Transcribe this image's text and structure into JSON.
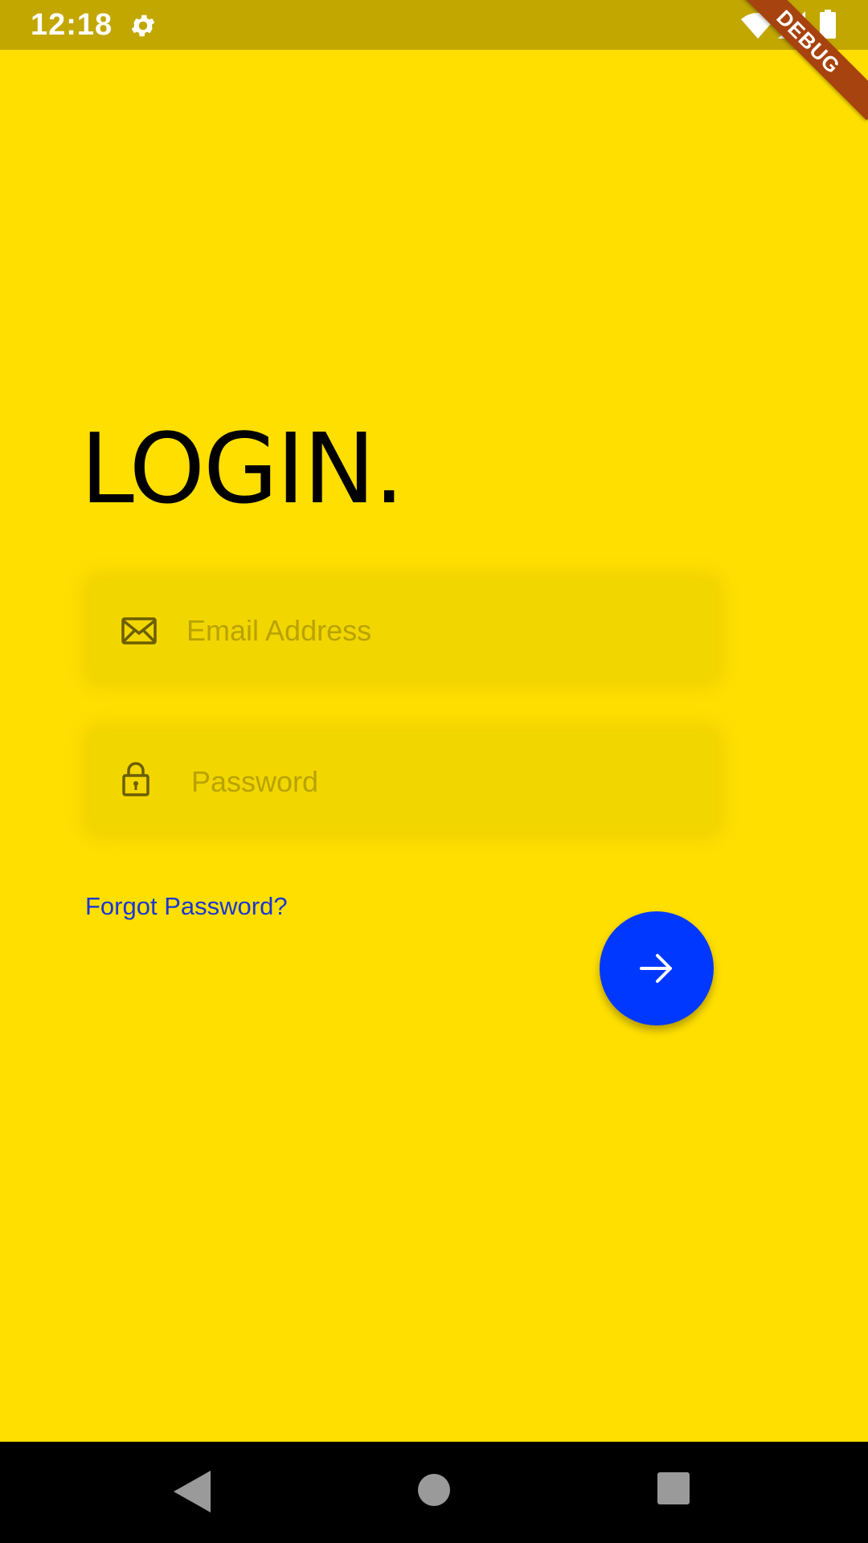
{
  "status_bar": {
    "time": "12:18"
  },
  "debug_banner": {
    "label": "DEBUG"
  },
  "login": {
    "title": "LOGIN.",
    "email_placeholder": "Email Address",
    "password_placeholder": "Password",
    "forgot_password": "Forgot Password?",
    "submit_icon": "arrow-right-icon"
  },
  "icons": {
    "email": "envelope-icon",
    "password": "lock-icon",
    "status_settings": "gear-icon"
  },
  "colors": {
    "background": "#FFDF00",
    "status_bar": "#C2A700",
    "field_bg": "#F2D600",
    "link": "#1A37D3",
    "fab": "#0038FF"
  }
}
